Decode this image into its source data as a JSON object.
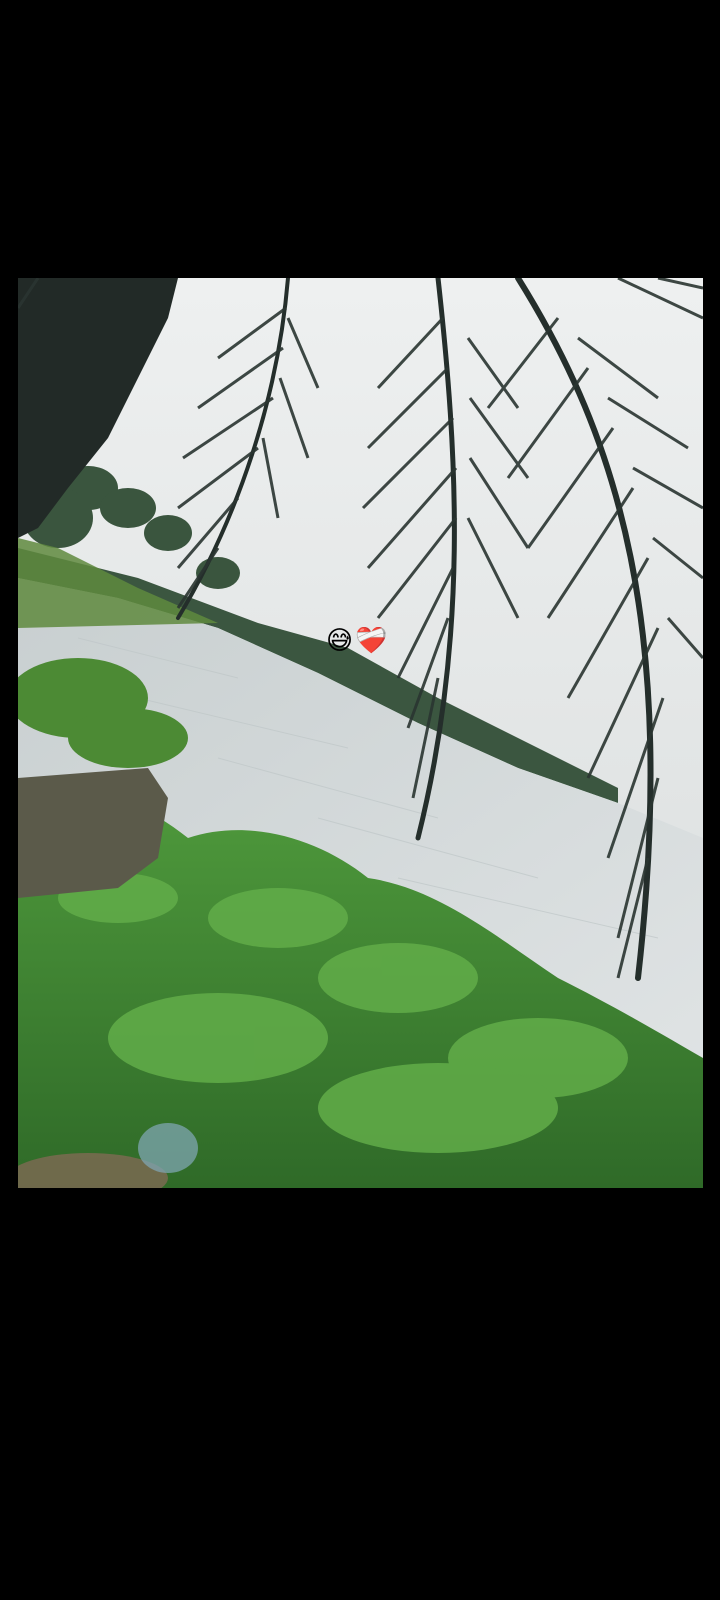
{
  "viewer": {
    "background_color": "#000000",
    "photo": {
      "description_icon": "video-frame-icon",
      "scene_colors": {
        "sky": "#e2e6e6",
        "water": "#d2d8d9",
        "far_trees": "#3f5a44",
        "foliage": "#3f8a33",
        "palm_frond": "#26302c"
      }
    },
    "overlay": {
      "emoji_1": "😅",
      "emoji_2": "❤️‍🩹"
    }
  }
}
